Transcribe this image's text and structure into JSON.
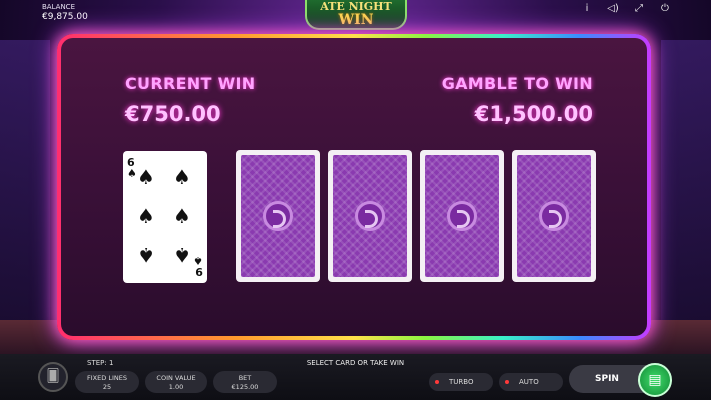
{
  "header": {
    "balance_label": "BALANCE",
    "balance_value": "€9,875.00",
    "logo_line1": "ATE NIGHT",
    "logo_line2": "WIN",
    "icons": [
      "info-icon",
      "sound-icon",
      "fullscreen-icon",
      "power-icon"
    ]
  },
  "gamble": {
    "current_win_label": "CURRENT WIN",
    "current_win_value": "€750.00",
    "gamble_to_win_label": "GAMBLE TO WIN",
    "gamble_to_win_value": "€1,500.00",
    "face_card": {
      "rank": "6",
      "rank_bottom": "9",
      "suit": "♠"
    },
    "hidden_cards": 4
  },
  "footer": {
    "step": "STEP: 1",
    "message": "SELECT CARD OR TAKE WIN",
    "fixed_lines_label": "FIXED LINES",
    "fixed_lines_value": "25",
    "coin_value_label": "COIN VALUE",
    "coin_value_value": "1.00",
    "bet_label": "BET",
    "bet_value": "€125.00",
    "turbo_label": "TURBO",
    "auto_label": "AUTO",
    "spin_label": "SPIN"
  },
  "colors": {
    "win_text": "#ffa3ff",
    "spin_green": "#3fdc6a",
    "toggle_off": "#ff3a3a"
  }
}
